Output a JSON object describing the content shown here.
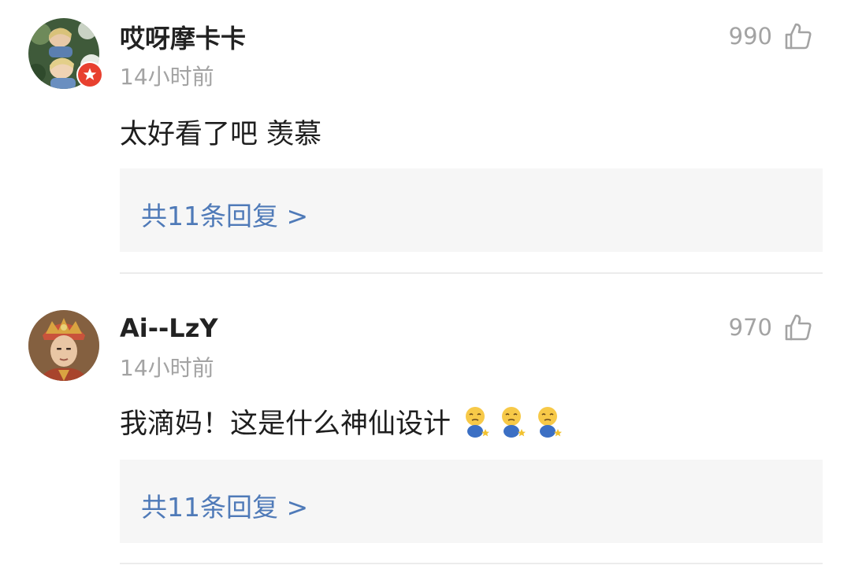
{
  "comments": [
    {
      "username": "哎呀摩卡卡",
      "time": "14小时前",
      "likes": "990",
      "content": "太好看了吧 羡慕",
      "replies_label": "共11条回复 >",
      "verified_badge": true,
      "avatar": "avatar-photo"
    },
    {
      "username": "Ai--LzY",
      "time": "14小时前",
      "likes": "970",
      "content": "我滴妈！这是什么神仙设计",
      "emoji_count": 3,
      "emoji": "pleading-face-emoji",
      "replies_label": "共11条回复 >",
      "avatar": "avatar-photo"
    }
  ],
  "colors": {
    "reply_link": "#4f7ab8",
    "muted_text": "#a3a3a3",
    "reply_box_bg": "#f6f6f6",
    "badge_red": "#e8402f",
    "divider": "#ececec"
  }
}
